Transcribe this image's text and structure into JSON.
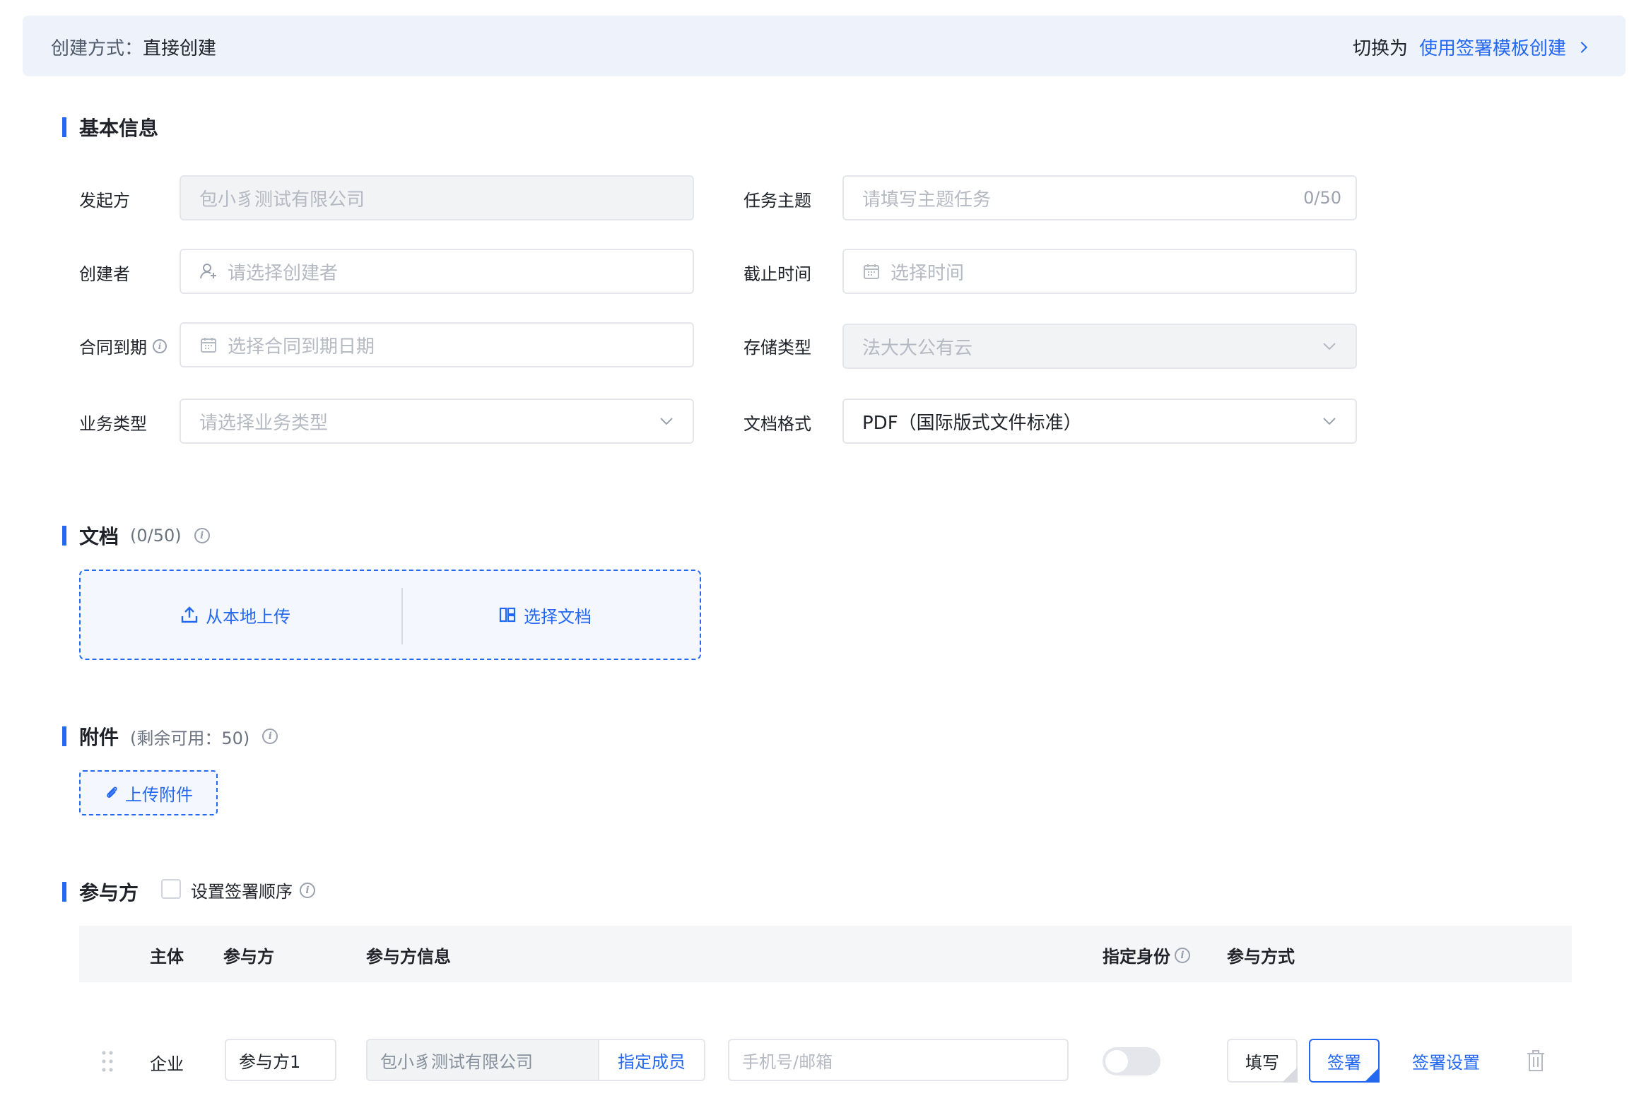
{
  "topbar": {
    "mode_label": "创建方式：",
    "mode_value": "直接创建",
    "switch_prefix": "切换为",
    "switch_link": "使用签署模板创建"
  },
  "basic": {
    "title": "基本信息",
    "initiator_label": "发起方",
    "initiator_value": "包小豸测试有限公司",
    "subject_label": "任务主题",
    "subject_placeholder": "请填写主题任务",
    "subject_count": "0/50",
    "creator_label": "创建者",
    "creator_placeholder": "请选择创建者",
    "deadline_label": "截止时间",
    "deadline_placeholder": "选择时间",
    "expiry_label": "合同到期",
    "expiry_placeholder": "选择合同到期日期",
    "storage_label": "存储类型",
    "storage_value": "法大大公有云",
    "biz_label": "业务类型",
    "biz_placeholder": "请选择业务类型",
    "format_label": "文档格式",
    "format_value": "PDF（国际版式文件标准）"
  },
  "docs": {
    "title": "文档",
    "count": "(0/50)",
    "upload_local": "从本地上传",
    "choose_doc": "选择文档"
  },
  "attachments": {
    "title": "附件",
    "remaining": "(剩余可用：50)",
    "upload_btn": "上传附件"
  },
  "participants": {
    "title": "参与方",
    "order_label": "设置签署顺序",
    "columns": {
      "subject": "主体",
      "party": "参与方",
      "info": "参与方信息",
      "identity": "指定身份",
      "method": "参与方式"
    },
    "rows": [
      {
        "subject": "企业",
        "party": "参与方1",
        "org": "包小豸测试有限公司",
        "assign_member": "指定成员",
        "contact_placeholder": "手机号/邮箱",
        "fill": "填写",
        "sign": "签署",
        "sign_settings": "签署设置"
      }
    ]
  },
  "colors": {
    "accent": "#2468f2",
    "topbar_bg": "#eef2fb"
  }
}
